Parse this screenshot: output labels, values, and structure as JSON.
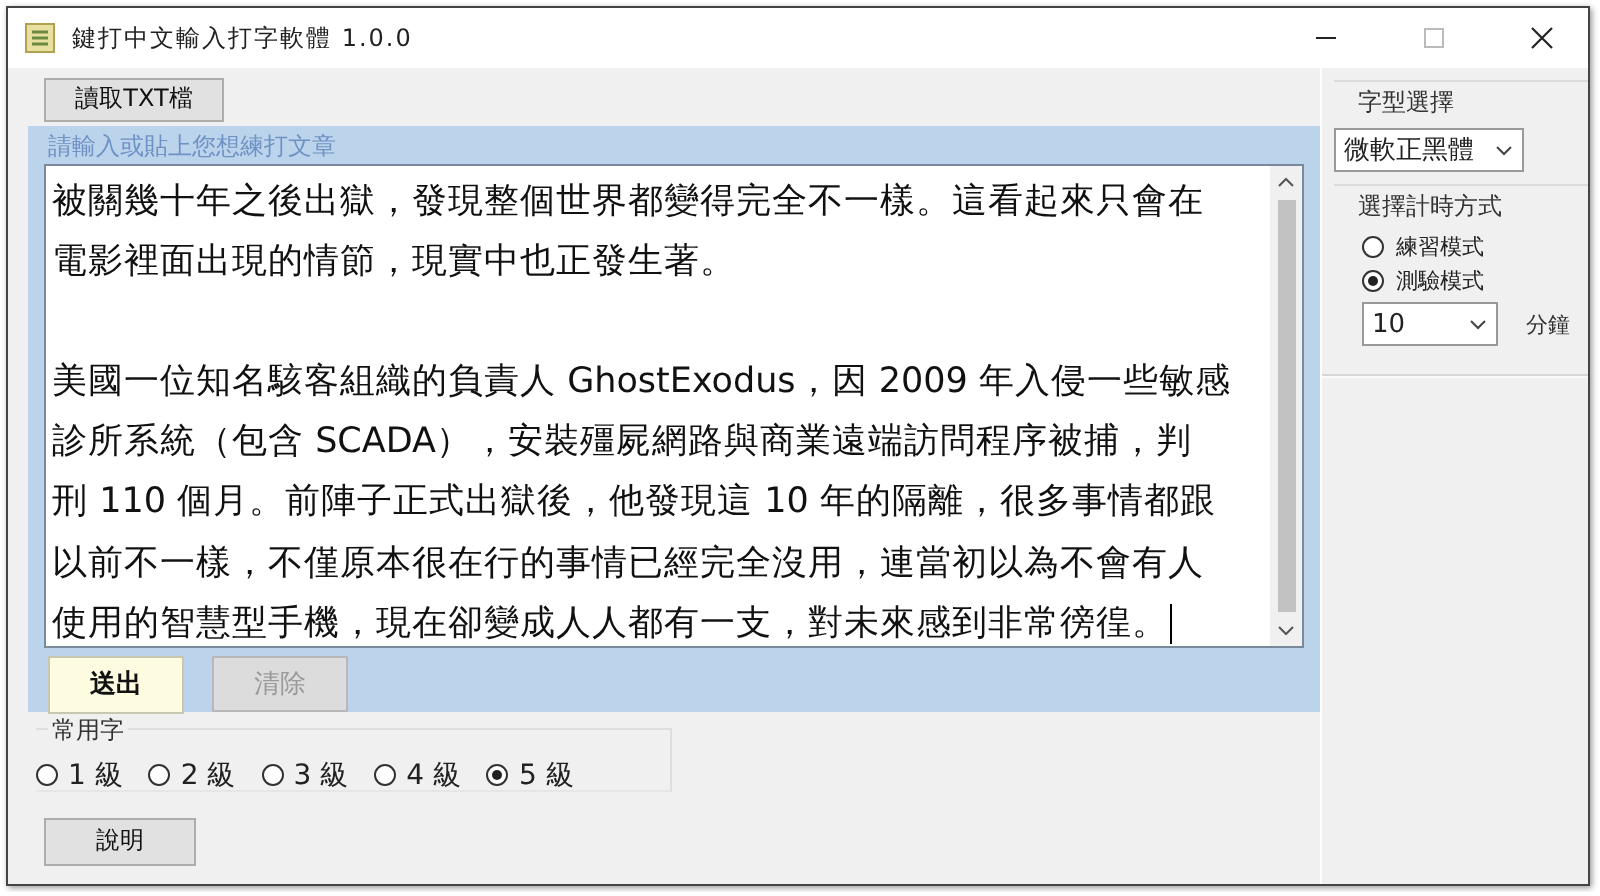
{
  "window": {
    "title": "鍵打中文輸入打字軟體 1.0.0"
  },
  "load_button": "讀取TXT檔",
  "editor": {
    "label": "請輸入或貼上您想練打文章",
    "paragraphs": [
      [
        "被關幾十年之後出獄，發現整個世界都變得完全不一樣。這看起來只會在",
        "電影裡面出現的情節，現實中也正發生著。"
      ],
      [
        "美國一位知名駭客組織的負責人 GhostExodus，因 2009 年入侵一些敏感",
        "診所系統（包含 SCADA），安裝殭屍網路與商業遠端訪問程序被捕，判",
        "刑 110 個月。前陣子正式出獄後，他發現這 10 年的隔離，很多事情都跟",
        "以前不一樣，不僅原本很在行的事情已經完全沒用，連當初以為不會有人",
        "使用的智慧型手機，現在卻變成人人都有一支，對未來感到非常徬徨。"
      ]
    ],
    "buttons": [
      {
        "label": "送出",
        "disabled": false,
        "default": true
      },
      {
        "label": "清除",
        "disabled": true,
        "default": false
      }
    ]
  },
  "font": {
    "label": "字型選擇",
    "value": "微軟正黑體"
  },
  "timing": {
    "label": "選擇計時方式",
    "modes": [
      {
        "label": "練習模式",
        "selected": false
      },
      {
        "label": "測驗模式",
        "selected": true
      }
    ],
    "minutes": "10",
    "unit": "分鐘"
  },
  "common_chars": {
    "label": "常用字",
    "levels": [
      {
        "label": "1 級",
        "selected": false
      },
      {
        "label": "2 級",
        "selected": false
      },
      {
        "label": "3 級",
        "selected": false
      },
      {
        "label": "4 級",
        "selected": false
      },
      {
        "label": "5 級",
        "selected": true
      }
    ]
  },
  "help_button": "說明"
}
